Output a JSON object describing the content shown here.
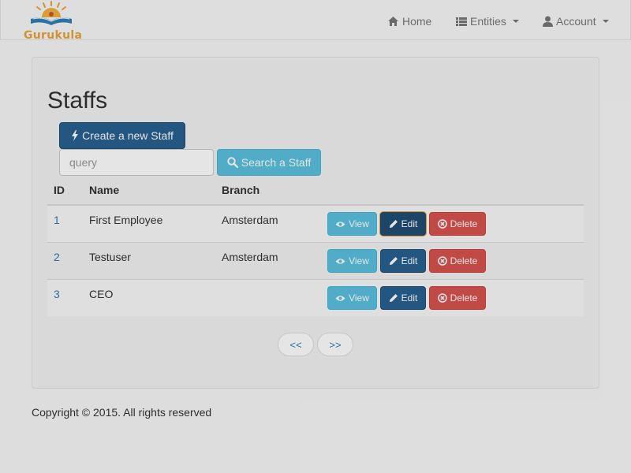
{
  "brand": {
    "name": "Gurukula",
    "color": "#e8a33a"
  },
  "nav": {
    "home": {
      "label": "Home",
      "icon": "home-icon"
    },
    "entities": {
      "label": "Entities",
      "icon": "list-icon"
    },
    "account": {
      "label": "Account",
      "icon": "user-icon"
    }
  },
  "page": {
    "title": "Staffs"
  },
  "toolbar": {
    "create_label": "Create a new Staff",
    "search_placeholder": "query",
    "search_value": "",
    "search_label": "Search a Staff"
  },
  "table": {
    "columns": [
      "ID",
      "Name",
      "Branch"
    ],
    "rows": [
      {
        "id": "1",
        "name": "First Employee",
        "branch": "Amsterdam"
      },
      {
        "id": "2",
        "name": "Testuser",
        "branch": "Amsterdam"
      },
      {
        "id": "3",
        "name": "CEO",
        "branch": ""
      }
    ],
    "actions": {
      "view": "View",
      "edit": "Edit",
      "delete": "Delete"
    }
  },
  "pager": {
    "prev": "<<",
    "next": ">>"
  },
  "footer": {
    "text": "Copyright © 2015. All rights reserved"
  },
  "colors": {
    "primary": "#286090",
    "info": "#5bc0de",
    "danger": "#d9534f",
    "link": "#337ab7"
  }
}
